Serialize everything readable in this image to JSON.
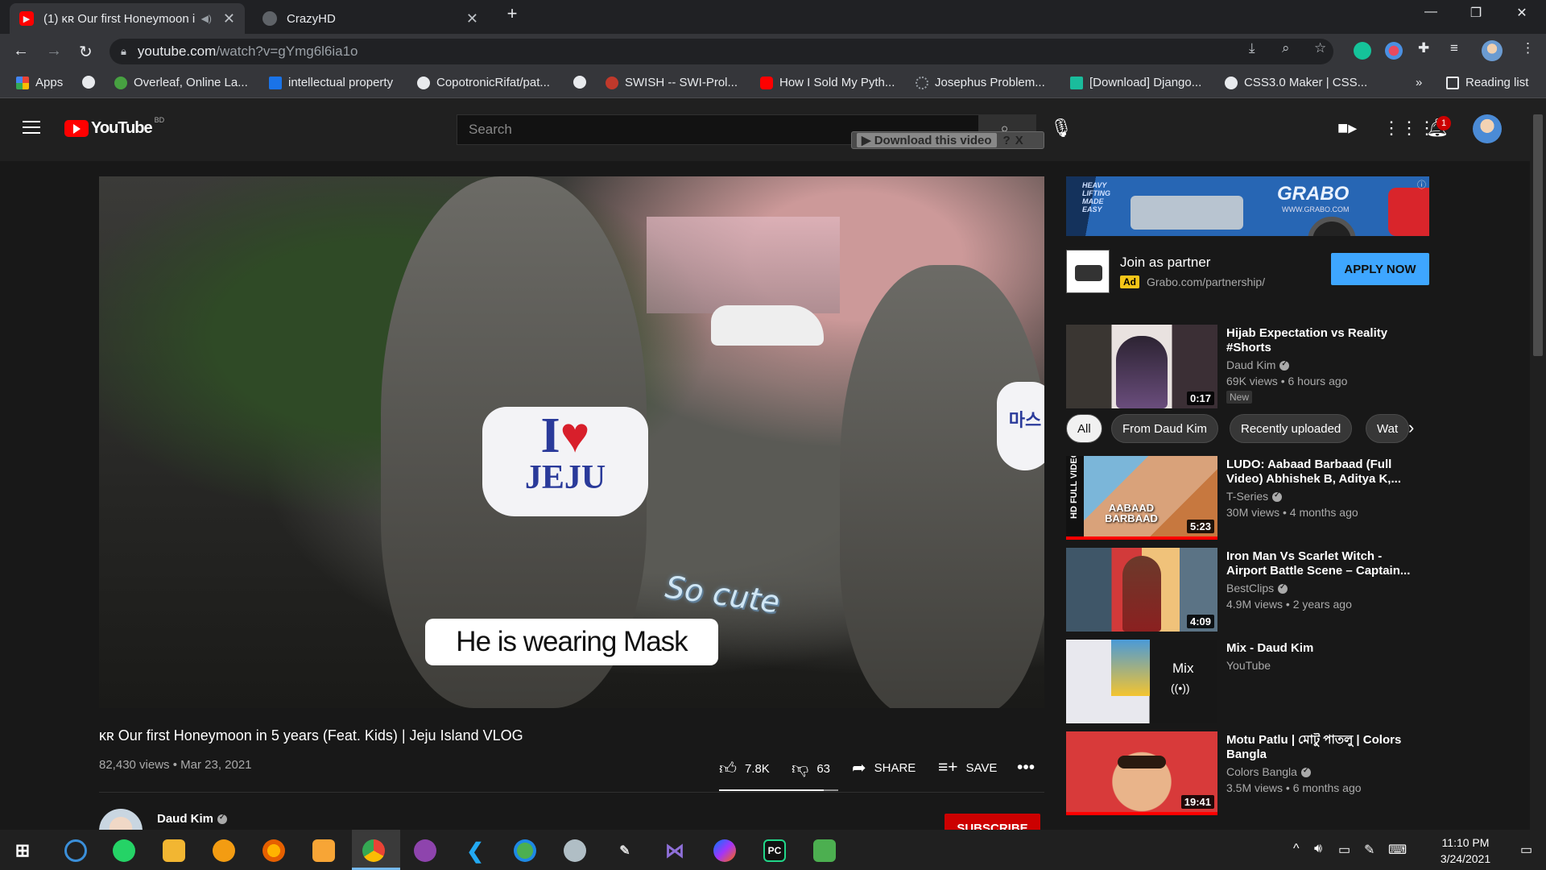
{
  "browser": {
    "tabs": [
      {
        "title": "(1) ᴋʀ Our first Honeymoon i",
        "active": true
      },
      {
        "title": "CrazyHD",
        "active": false
      }
    ],
    "new_tab": "+",
    "url_host": "youtube.com",
    "url_path": "/watch?v=gYmg6l6ia1o",
    "bookmarks": [
      {
        "label": "Apps",
        "color": "#ea4335"
      },
      {
        "label": "",
        "color": "#e8eaed"
      },
      {
        "label": "Overleaf, Online La...",
        "color": "#47a141"
      },
      {
        "label": "intellectual property",
        "color": "#1a73e8"
      },
      {
        "label": "CopotronicRifat/pat...",
        "color": "#e8eaed"
      },
      {
        "label": "",
        "color": "#e8eaed"
      },
      {
        "label": "SWISH -- SWI-Prol...",
        "color": "#c0392b"
      },
      {
        "label": "How I Sold My Pyth...",
        "color": "#ff0000"
      },
      {
        "label": "Josephus Problem...",
        "color": "#9aa0a6"
      },
      {
        "label": "[Download] Django...",
        "color": "#1abc9c"
      },
      {
        "label": "CSS3.0 Maker | CSS...",
        "color": "#e8eaed"
      }
    ],
    "bookmarks_more": "»",
    "reading_list": "Reading list"
  },
  "youtube": {
    "logo_text": "YouTube",
    "country": "BD",
    "search_placeholder": "Search",
    "download_bar": "Download this video",
    "download_help": "?",
    "download_close": "X",
    "notification_count": "1"
  },
  "video": {
    "caption_main": "He is wearing Mask",
    "caption_cute": "So cute",
    "mask_text_1": "I",
    "mask_heart": "♥",
    "mask_text_2": "JEJU",
    "mask_text_side": "마스",
    "title": "ᴋʀ Our first Honeymoon in 5 years (Feat. Kids) | Jeju Island VLOG",
    "meta": "82,430 views • Mar 23, 2021",
    "likes": "7.8K",
    "dislikes": "63",
    "share": "SHARE",
    "save": "SAVE",
    "like_ratio": 0.88,
    "channel": "Daud Kim",
    "subscribe": "SUBSCRIBE"
  },
  "ad": {
    "banner_brand": "GRABO",
    "banner_url": "WWW.GRABO.COM",
    "banner_tagline": "HEAVY LIFTING MADE EASY",
    "title": "Join as partner",
    "badge": "Ad",
    "url": "Grabo.com/partnership/",
    "cta": "APPLY NOW"
  },
  "chips": [
    "All",
    "From Daud Kim",
    "Recently uploaded",
    "Wat"
  ],
  "recommendations": [
    {
      "title": "Hijab Expectation vs Reality #Shorts",
      "channel": "Daud Kim",
      "verified": true,
      "views": "69K views • 6 hours ago",
      "duration": "0:17",
      "badge": "New"
    },
    {
      "title": "LUDO: Aabaad Barbaad (Full Video) Abhishek B, Aditya K,...",
      "channel": "T-Series",
      "verified": true,
      "views": "30M views • 4 months ago",
      "duration": "5:23",
      "thumb_text": "AABAAD BARBAAD",
      "side_text": "HD FULL VIDEO",
      "watched": 1.0
    },
    {
      "title": "Iron Man Vs Scarlet Witch - Airport Battle Scene – Captain...",
      "channel": "BestClips",
      "verified": true,
      "views": "4.9M views • 2 years ago",
      "duration": "4:09"
    },
    {
      "title": "Mix - Daud Kim",
      "channel": "YouTube",
      "verified": false,
      "views": "",
      "duration": "",
      "mix_label": "Mix",
      "mix_icon": "((•))"
    },
    {
      "title": "Motu Patlu | মোটু পাতলু | Colors Bangla",
      "channel": "Colors Bangla",
      "verified": true,
      "views": "3.5M views • 6 months ago",
      "duration": "19:41",
      "watched": 1.0
    }
  ],
  "taskbar": {
    "time": "11:10 PM",
    "date": "3/24/2021"
  }
}
